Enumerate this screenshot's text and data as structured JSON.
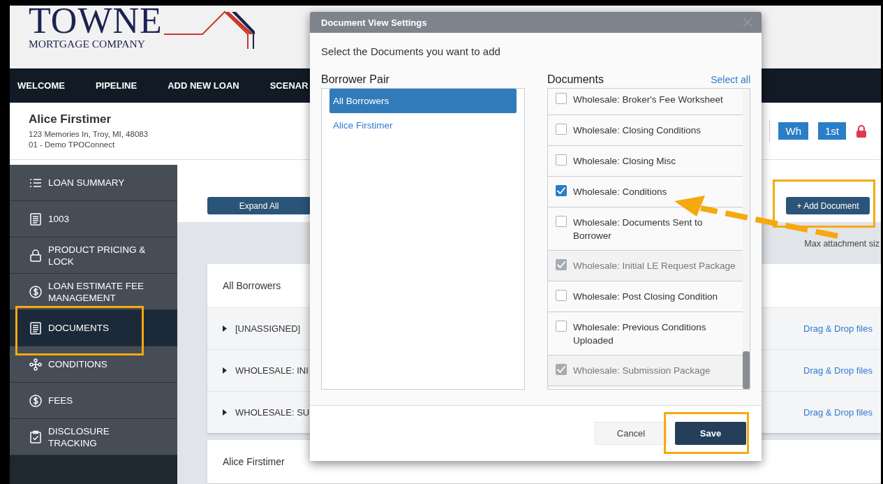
{
  "logo": {
    "name": "TOWNE",
    "subtitle": "MORTGAGE COMPANY"
  },
  "nav": [
    "WELCOME",
    "PIPELINE",
    "ADD NEW LOAN",
    "SCENAR"
  ],
  "borrower": {
    "name": "Alice Firstimer",
    "address": "123 Memories In, Troy, MI, 48083",
    "company": "01 - Demo TPOConnect"
  },
  "badges": [
    "Wh",
    "1st"
  ],
  "sidebar": [
    {
      "label": "LOAN SUMMARY",
      "selected": false
    },
    {
      "label": "1003",
      "selected": false
    },
    {
      "label": "PRODUCT PRICING & LOCK",
      "selected": false
    },
    {
      "label": "LOAN ESTIMATE FEE MANAGEMENT",
      "selected": false
    },
    {
      "label": "DOCUMENTS",
      "selected": true
    },
    {
      "label": "CONDITIONS",
      "selected": false
    },
    {
      "label": "FEES",
      "selected": false
    },
    {
      "label": "DISCLOSURE TRACKING",
      "selected": false
    }
  ],
  "expand_all": "Expand All",
  "add_document": "+ Add Document",
  "max_attachment": "Max attachment siz",
  "groups": [
    {
      "title": "All Borrowers",
      "rows": [
        {
          "label": "[UNASSIGNED]",
          "action": "Drag & Drop files"
        },
        {
          "label": "WHOLESALE: INI",
          "action": "Drag & Drop files"
        },
        {
          "label": "WHOLESALE: SU",
          "action": "Drag & Drop files"
        }
      ]
    },
    {
      "title": "Alice Firstimer"
    }
  ],
  "modal": {
    "title": "Document View Settings",
    "prompt": "Select the Documents you want to add",
    "borrower_pair": {
      "heading": "Borrower Pair",
      "items": [
        {
          "label": "All Borrowers",
          "selected": true
        },
        {
          "label": "Alice Firstimer",
          "selected": false
        }
      ]
    },
    "documents": {
      "heading": "Documents",
      "select_all": "Select all",
      "items": [
        {
          "label": "Wholesale: Broker's Fee Worksheet",
          "checked": false,
          "disabled": false
        },
        {
          "label": "Wholesale: Closing Conditions",
          "checked": false,
          "disabled": false
        },
        {
          "label": "Wholesale: Closing Misc",
          "checked": false,
          "disabled": false
        },
        {
          "label": "Wholesale: Conditions",
          "checked": true,
          "disabled": false
        },
        {
          "label": "Wholesale: Documents Sent to Borrower",
          "checked": false,
          "disabled": false
        },
        {
          "label": "Wholesale: Initial LE Request Package",
          "checked": true,
          "disabled": true
        },
        {
          "label": "Wholesale: Post Closing Condition",
          "checked": false,
          "disabled": false
        },
        {
          "label": "Wholesale: Previous Conditions Uploaded",
          "checked": false,
          "disabled": false
        },
        {
          "label": "Wholesale: Submission Package",
          "checked": true,
          "disabled": true
        }
      ]
    },
    "cancel": "Cancel",
    "save": "Save"
  }
}
